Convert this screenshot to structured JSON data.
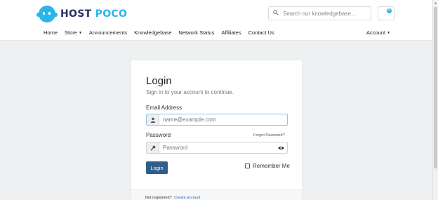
{
  "brand": {
    "name_part1": "HOST",
    "name_part2": "POCO",
    "accent_color": "#29b6e8",
    "dark_color": "#2a2e6b"
  },
  "header": {
    "search_placeholder": "Search our knowledgebase...",
    "search_icon": "search-icon",
    "cart_icon": "cart-icon",
    "cart_count": "0"
  },
  "nav": {
    "items": [
      {
        "label": "Home"
      },
      {
        "label": "Store",
        "dropdown": true
      },
      {
        "label": "Announcements"
      },
      {
        "label": "Knowledgebase"
      },
      {
        "label": "Network Status"
      },
      {
        "label": "Affiliates"
      },
      {
        "label": "Contact Us"
      }
    ],
    "account": "Account"
  },
  "login": {
    "title": "Login",
    "subtitle": "Sign in to your account to continue.",
    "email_label": "Email Address",
    "email_placeholder": "name@example.com",
    "email_icon": "user-icon",
    "password_label": "Password",
    "password_placeholder": "Password",
    "password_icon": "key-icon",
    "forgot_link": "Forgot Password?",
    "show_password_icon": "eye-icon",
    "submit_label": "Login",
    "remember_label": "Remember Me",
    "remember_checked": false,
    "button_color": "#305d8c"
  },
  "footer": {
    "not_registered": "Not registered?",
    "create_account": "Create account"
  }
}
